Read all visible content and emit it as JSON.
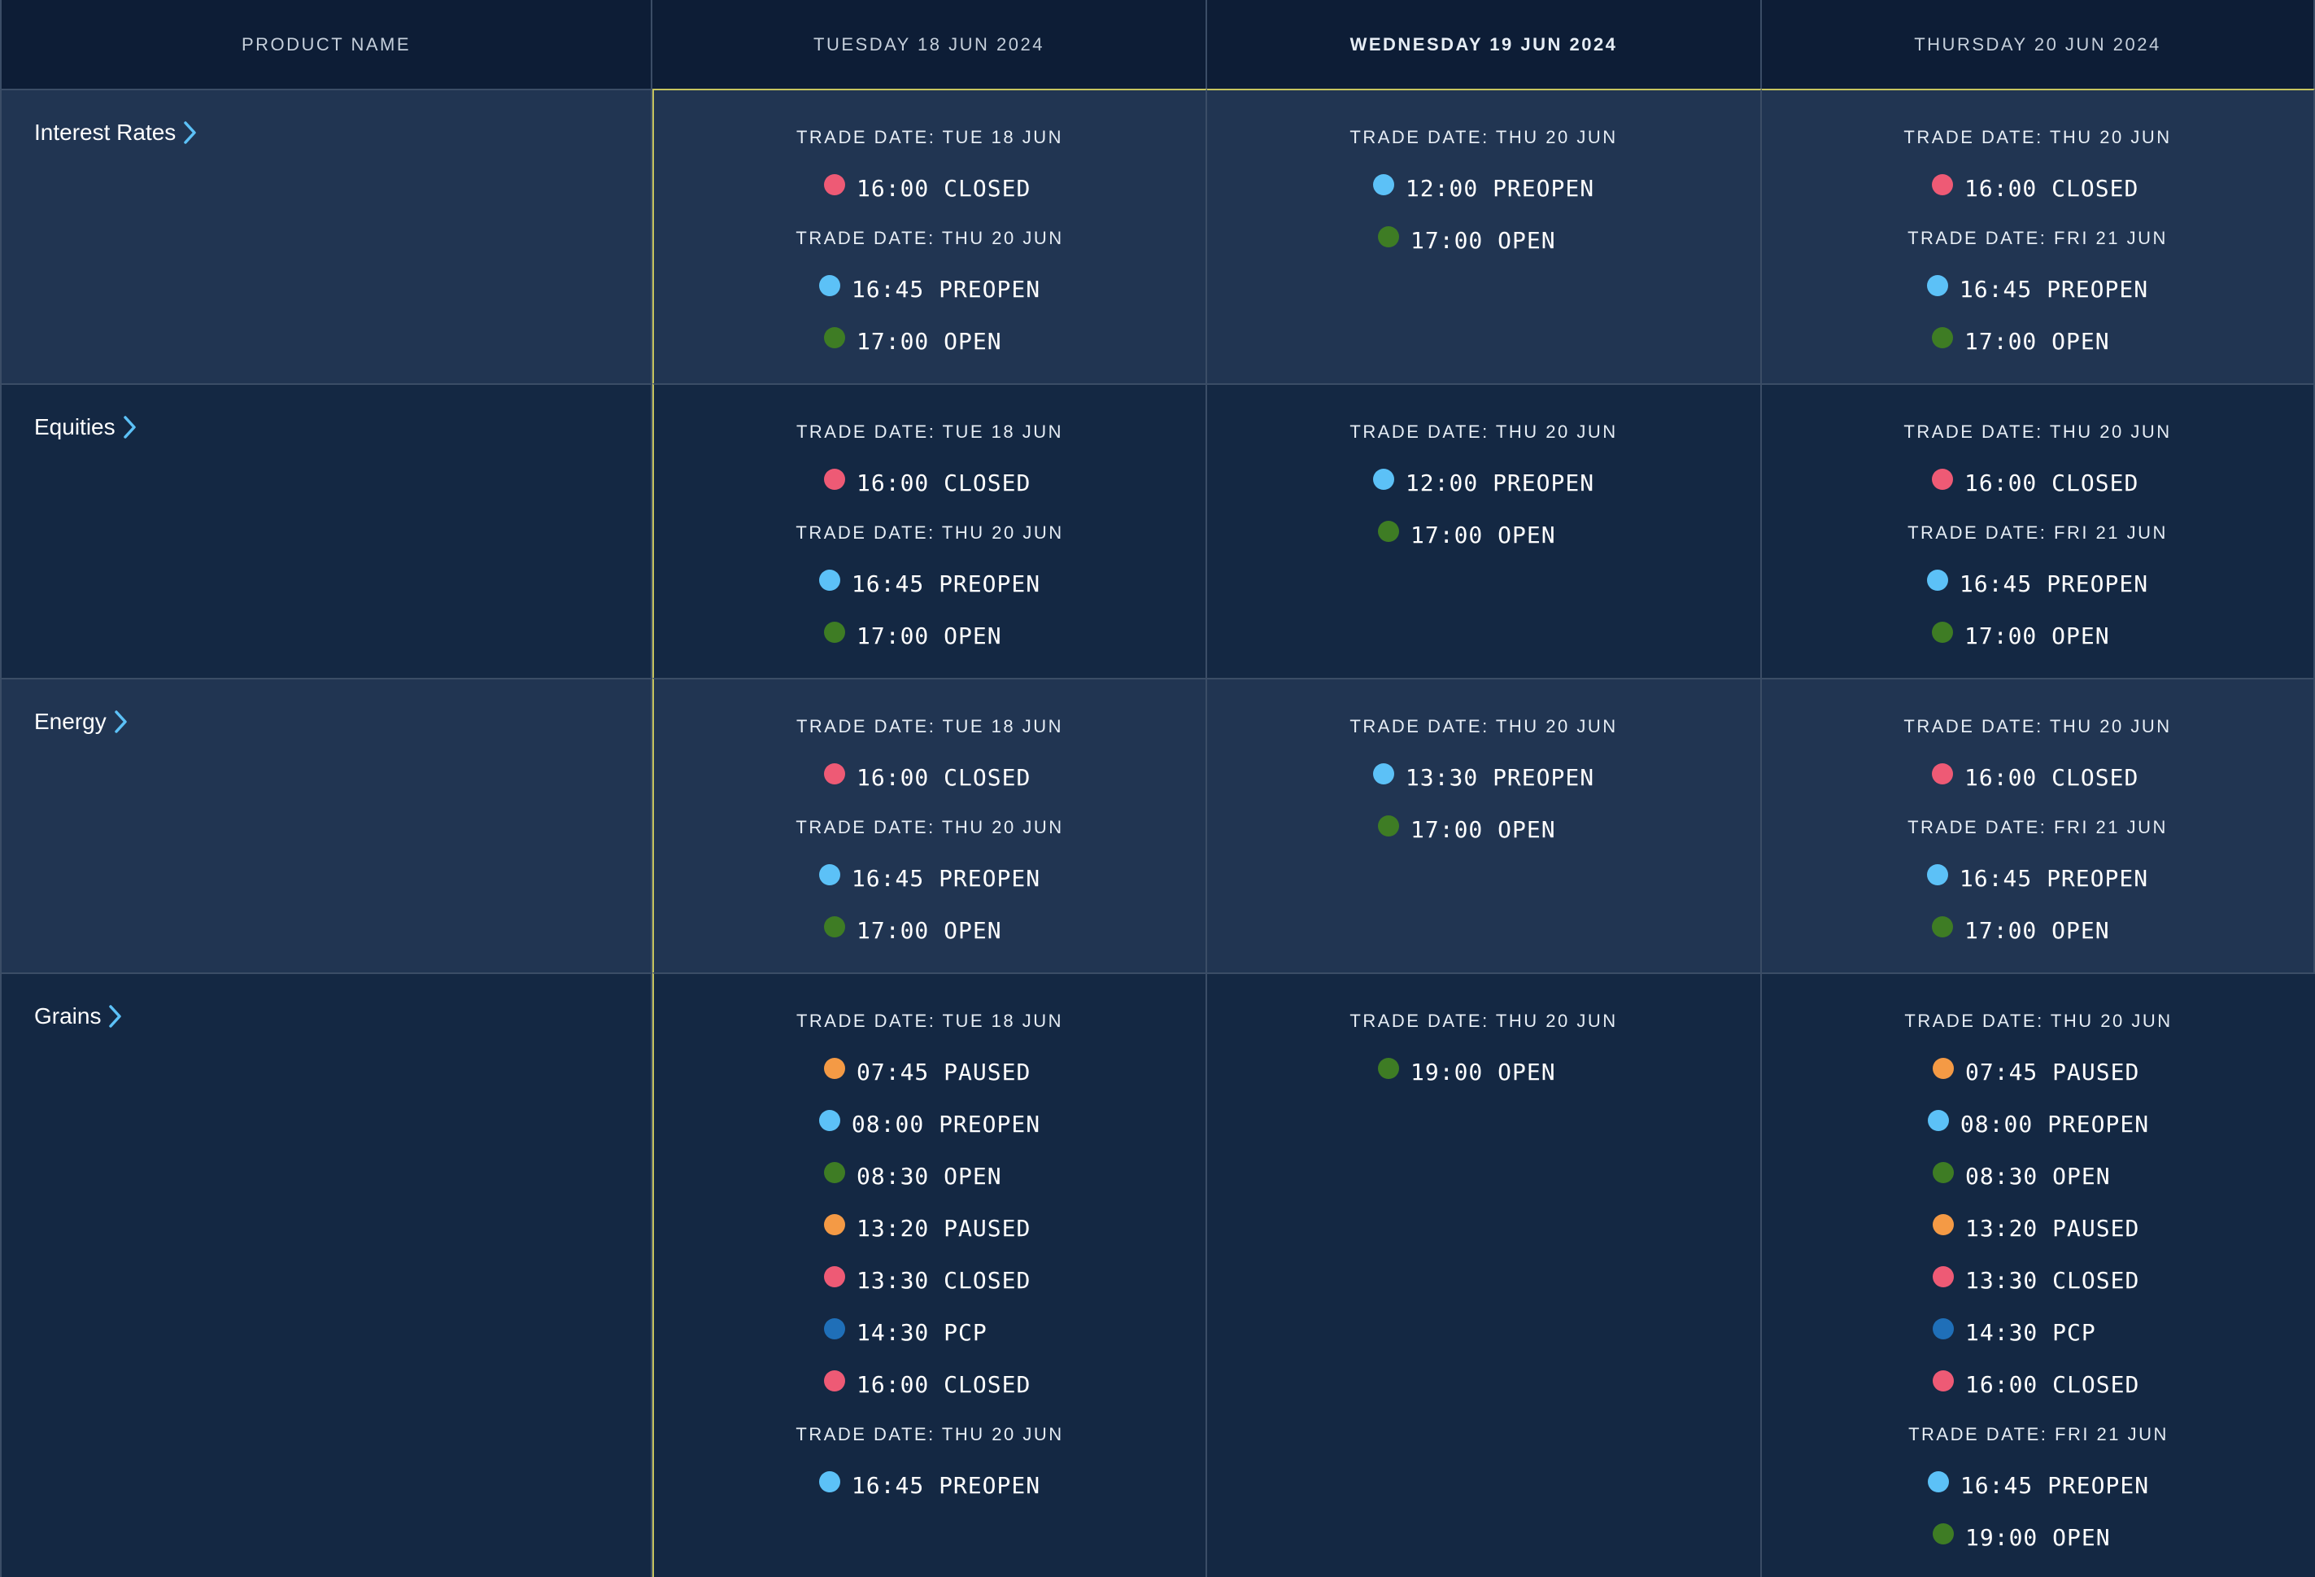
{
  "header": {
    "product_col": "PRODUCT NAME",
    "days": [
      "TUESDAY 18 JUN 2024",
      "WEDNESDAY 19 JUN 2024",
      "THURSDAY 20 JUN 2024"
    ]
  },
  "status_colors": {
    "CLOSED": "#ee5a75",
    "PREOPEN": "#5cc1f7",
    "OPEN": "#3e7c24",
    "PAUSED": "#f49a45",
    "PCP": "#1f6fb8"
  },
  "rows": [
    {
      "name": "Interest Rates",
      "cells": [
        [
          {
            "trade_date": "TRADE DATE: TUE 18 JUN",
            "events": [
              {
                "time": "16:00",
                "status": "CLOSED"
              }
            ]
          },
          {
            "trade_date": "TRADE DATE: THU 20 JUN",
            "events": [
              {
                "time": "16:45",
                "status": "PREOPEN"
              },
              {
                "time": "17:00",
                "status": "OPEN"
              }
            ]
          }
        ],
        [
          {
            "trade_date": "TRADE DATE: THU 20 JUN",
            "events": [
              {
                "time": "12:00",
                "status": "PREOPEN"
              },
              {
                "time": "17:00",
                "status": "OPEN"
              }
            ]
          }
        ],
        [
          {
            "trade_date": "TRADE DATE: THU 20 JUN",
            "events": [
              {
                "time": "16:00",
                "status": "CLOSED"
              }
            ]
          },
          {
            "trade_date": "TRADE DATE: FRI 21 JUN",
            "events": [
              {
                "time": "16:45",
                "status": "PREOPEN"
              },
              {
                "time": "17:00",
                "status": "OPEN"
              }
            ]
          }
        ]
      ]
    },
    {
      "name": "Equities",
      "cells": [
        [
          {
            "trade_date": "TRADE DATE: TUE 18 JUN",
            "events": [
              {
                "time": "16:00",
                "status": "CLOSED"
              }
            ]
          },
          {
            "trade_date": "TRADE DATE: THU 20 JUN",
            "events": [
              {
                "time": "16:45",
                "status": "PREOPEN"
              },
              {
                "time": "17:00",
                "status": "OPEN"
              }
            ]
          }
        ],
        [
          {
            "trade_date": "TRADE DATE: THU 20 JUN",
            "events": [
              {
                "time": "12:00",
                "status": "PREOPEN"
              },
              {
                "time": "17:00",
                "status": "OPEN"
              }
            ]
          }
        ],
        [
          {
            "trade_date": "TRADE DATE: THU 20 JUN",
            "events": [
              {
                "time": "16:00",
                "status": "CLOSED"
              }
            ]
          },
          {
            "trade_date": "TRADE DATE: FRI 21 JUN",
            "events": [
              {
                "time": "16:45",
                "status": "PREOPEN"
              },
              {
                "time": "17:00",
                "status": "OPEN"
              }
            ]
          }
        ]
      ]
    },
    {
      "name": "Energy",
      "cells": [
        [
          {
            "trade_date": "TRADE DATE: TUE 18 JUN",
            "events": [
              {
                "time": "16:00",
                "status": "CLOSED"
              }
            ]
          },
          {
            "trade_date": "TRADE DATE: THU 20 JUN",
            "events": [
              {
                "time": "16:45",
                "status": "PREOPEN"
              },
              {
                "time": "17:00",
                "status": "OPEN"
              }
            ]
          }
        ],
        [
          {
            "trade_date": "TRADE DATE: THU 20 JUN",
            "events": [
              {
                "time": "13:30",
                "status": "PREOPEN"
              },
              {
                "time": "17:00",
                "status": "OPEN"
              }
            ]
          }
        ],
        [
          {
            "trade_date": "TRADE DATE: THU 20 JUN",
            "events": [
              {
                "time": "16:00",
                "status": "CLOSED"
              }
            ]
          },
          {
            "trade_date": "TRADE DATE: FRI 21 JUN",
            "events": [
              {
                "time": "16:45",
                "status": "PREOPEN"
              },
              {
                "time": "17:00",
                "status": "OPEN"
              }
            ]
          }
        ]
      ]
    },
    {
      "name": "Grains",
      "cells": [
        [
          {
            "trade_date": "TRADE DATE: TUE 18 JUN",
            "events": [
              {
                "time": "07:45",
                "status": "PAUSED"
              },
              {
                "time": "08:00",
                "status": "PREOPEN"
              },
              {
                "time": "08:30",
                "status": "OPEN"
              },
              {
                "time": "13:20",
                "status": "PAUSED"
              },
              {
                "time": "13:30",
                "status": "CLOSED"
              },
              {
                "time": "14:30",
                "status": "PCP"
              },
              {
                "time": "16:00",
                "status": "CLOSED"
              }
            ]
          },
          {
            "trade_date": "TRADE DATE: THU 20 JUN",
            "events": [
              {
                "time": "16:45",
                "status": "PREOPEN"
              }
            ]
          }
        ],
        [
          {
            "trade_date": "TRADE DATE: THU 20 JUN",
            "events": [
              {
                "time": "19:00",
                "status": "OPEN"
              }
            ]
          }
        ],
        [
          {
            "trade_date": "TRADE DATE: THU 20 JUN",
            "events": [
              {
                "time": "07:45",
                "status": "PAUSED"
              },
              {
                "time": "08:00",
                "status": "PREOPEN"
              },
              {
                "time": "08:30",
                "status": "OPEN"
              },
              {
                "time": "13:20",
                "status": "PAUSED"
              },
              {
                "time": "13:30",
                "status": "CLOSED"
              },
              {
                "time": "14:30",
                "status": "PCP"
              },
              {
                "time": "16:00",
                "status": "CLOSED"
              }
            ]
          },
          {
            "trade_date": "TRADE DATE: FRI 21 JUN",
            "events": [
              {
                "time": "16:45",
                "status": "PREOPEN"
              },
              {
                "time": "19:00",
                "status": "OPEN"
              }
            ]
          }
        ]
      ]
    }
  ]
}
